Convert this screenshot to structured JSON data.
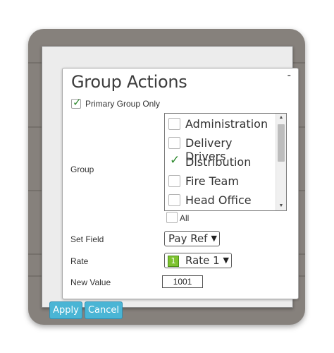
{
  "dialog": {
    "title": "Group Actions",
    "minimize_label": "-"
  },
  "primary_group": {
    "label": "Primary Group Only",
    "checked": true
  },
  "group": {
    "label": "Group",
    "items": [
      {
        "label": "Administration",
        "checked": false
      },
      {
        "label": "Delivery Drivers",
        "checked": false
      },
      {
        "label": "Distribution",
        "checked": true
      },
      {
        "label": "Fire Team",
        "checked": false
      },
      {
        "label": "Head Office",
        "checked": false
      }
    ],
    "all_label": "All",
    "all_checked": false
  },
  "set_field": {
    "label": "Set Field",
    "value": "Pay Ref"
  },
  "rate": {
    "label": "Rate",
    "badge": "1",
    "value": "Rate 1",
    "badge_color": "#7ec230"
  },
  "new_value": {
    "label": "New Value",
    "value": "1001"
  },
  "buttons": {
    "apply": "Apply",
    "cancel": "Cancel"
  },
  "colors": {
    "accent": "#4ab5d5",
    "frame": "#86817c",
    "check": "#2f8a2f"
  }
}
